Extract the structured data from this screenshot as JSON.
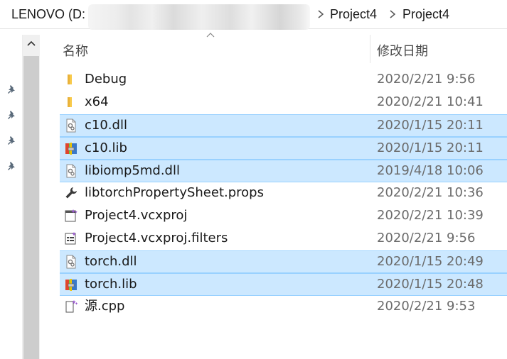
{
  "address": {
    "drive": "LENOVO (D:",
    "path": [
      "Project4",
      "Project4"
    ]
  },
  "columns": {
    "name": "名称",
    "date_modified": "修改日期"
  },
  "files": [
    {
      "name": "Debug",
      "date": "2020/2/21 9:56",
      "icon": "folder-icon",
      "selected": false
    },
    {
      "name": "x64",
      "date": "2020/2/21 10:41",
      "icon": "folder-icon",
      "selected": false
    },
    {
      "name": "c10.dll",
      "date": "2020/1/15 20:11",
      "icon": "dll-file-icon",
      "selected": true
    },
    {
      "name": "c10.lib",
      "date": "2020/1/15 20:11",
      "icon": "lib-archive-icon",
      "selected": true
    },
    {
      "name": "libiomp5md.dll",
      "date": "2019/4/18 10:06",
      "icon": "dll-file-icon",
      "selected": true
    },
    {
      "name": "libtorchPropertySheet.props",
      "date": "2020/2/21 10:36",
      "icon": "wrench-icon",
      "selected": false
    },
    {
      "name": "Project4.vcxproj",
      "date": "2020/2/21 10:39",
      "icon": "vcxproj-icon",
      "selected": false
    },
    {
      "name": "Project4.vcxproj.filters",
      "date": "2020/2/21 9:56",
      "icon": "filters-icon",
      "selected": false
    },
    {
      "name": "torch.dll",
      "date": "2020/1/15 20:49",
      "icon": "dll-file-icon",
      "selected": true
    },
    {
      "name": "torch.lib",
      "date": "2020/1/15 20:48",
      "icon": "lib-archive-icon",
      "selected": true
    },
    {
      "name": "源.cpp",
      "date": "2020/2/21 9:53",
      "icon": "cpp-file-icon",
      "selected": false
    }
  ],
  "colors": {
    "selection": "#cce8ff",
    "selection_border": "#99d1ff",
    "folder": "#f8c94a"
  }
}
